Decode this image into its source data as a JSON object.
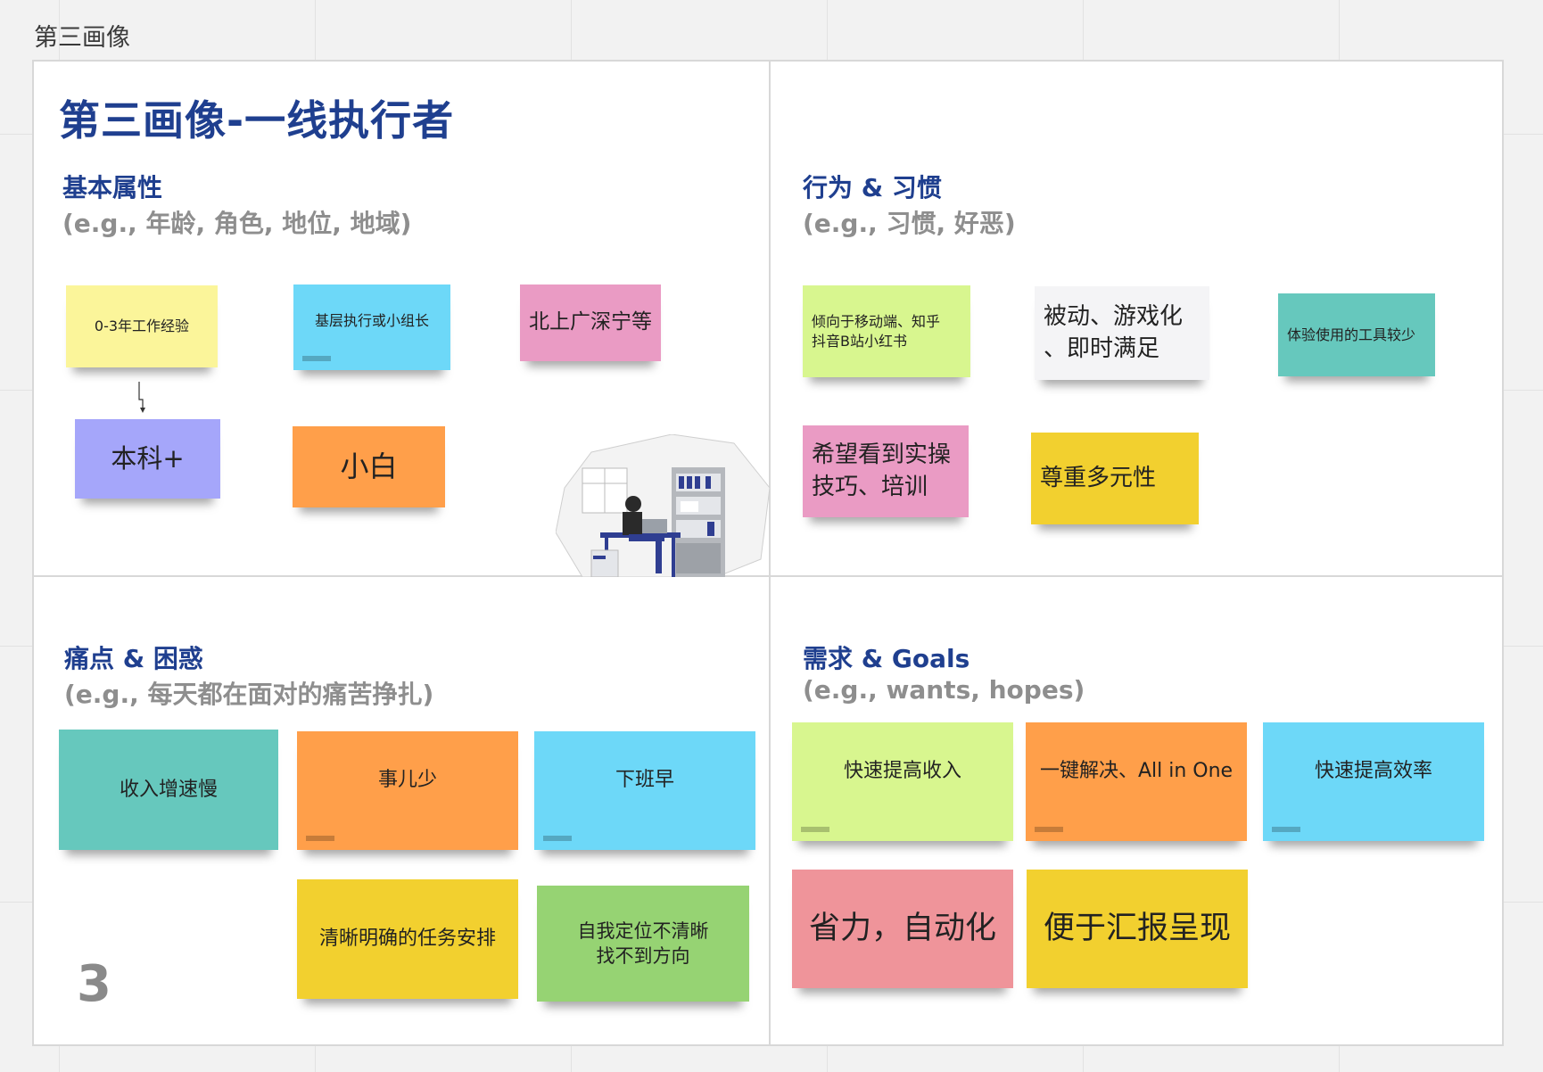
{
  "frame_label": "第三画像",
  "page_number": "3",
  "persona_title": "第三画像-一线执行者",
  "sections": {
    "basic": {
      "title": "基本属性",
      "hint": "(e.g., 年龄, 角色, 地位, 地域)"
    },
    "behavior": {
      "title": "行为 & 习惯",
      "hint": "(e.g., 习惯, 好恶)"
    },
    "pain": {
      "title": "痛点 & 困惑",
      "hint": "(e.g., 每天都在面对的痛苦挣扎)"
    },
    "needs": {
      "title": "需求 & Goals",
      "hint": "(e.g., wants, hopes)"
    }
  },
  "notes": {
    "basic": [
      {
        "text": "0-3年工作经验",
        "color": "#fbf59a"
      },
      {
        "text": "基层执行或小组长",
        "color": "#6dd8f8"
      },
      {
        "text": "北上广深宁等",
        "color": "#ea9bc4"
      },
      {
        "text": "本科+",
        "color": "#a5a6fa"
      },
      {
        "text": "小白",
        "color": "#ff9f4a"
      }
    ],
    "behavior": [
      {
        "text": "倾向于移动端、知乎\n抖音B站小红书",
        "color": "#d8f68f"
      },
      {
        "text": "被动、游戏化\n、即时满足",
        "color": "#f4f4f6"
      },
      {
        "text": "体验使用的工具较少",
        "color": "#66c8bd"
      },
      {
        "text": "希望看到实操\n技巧、培训",
        "color": "#ea9bc4"
      },
      {
        "text": "尊重多元性",
        "color": "#f2d02f"
      }
    ],
    "pain": [
      {
        "text": "收入增速慢",
        "color": "#66c8bd"
      },
      {
        "text": "事儿少",
        "color": "#ff9f4a"
      },
      {
        "text": "下班早",
        "color": "#6dd8f8"
      },
      {
        "text": "清晰明确的任务安排",
        "color": "#f2d02f"
      },
      {
        "text": "自我定位不清晰\n找不到方向",
        "color": "#96d373"
      }
    ],
    "needs": [
      {
        "text": "快速提高收入",
        "color": "#d8f68f"
      },
      {
        "text": "一键解决、All in One",
        "color": "#ff9f4a"
      },
      {
        "text": "快速提高效率",
        "color": "#6dd8f8"
      },
      {
        "text": "省力，自动化",
        "color": "#ef949a"
      },
      {
        "text": "便于汇报呈现",
        "color": "#f2d02f"
      }
    ]
  }
}
